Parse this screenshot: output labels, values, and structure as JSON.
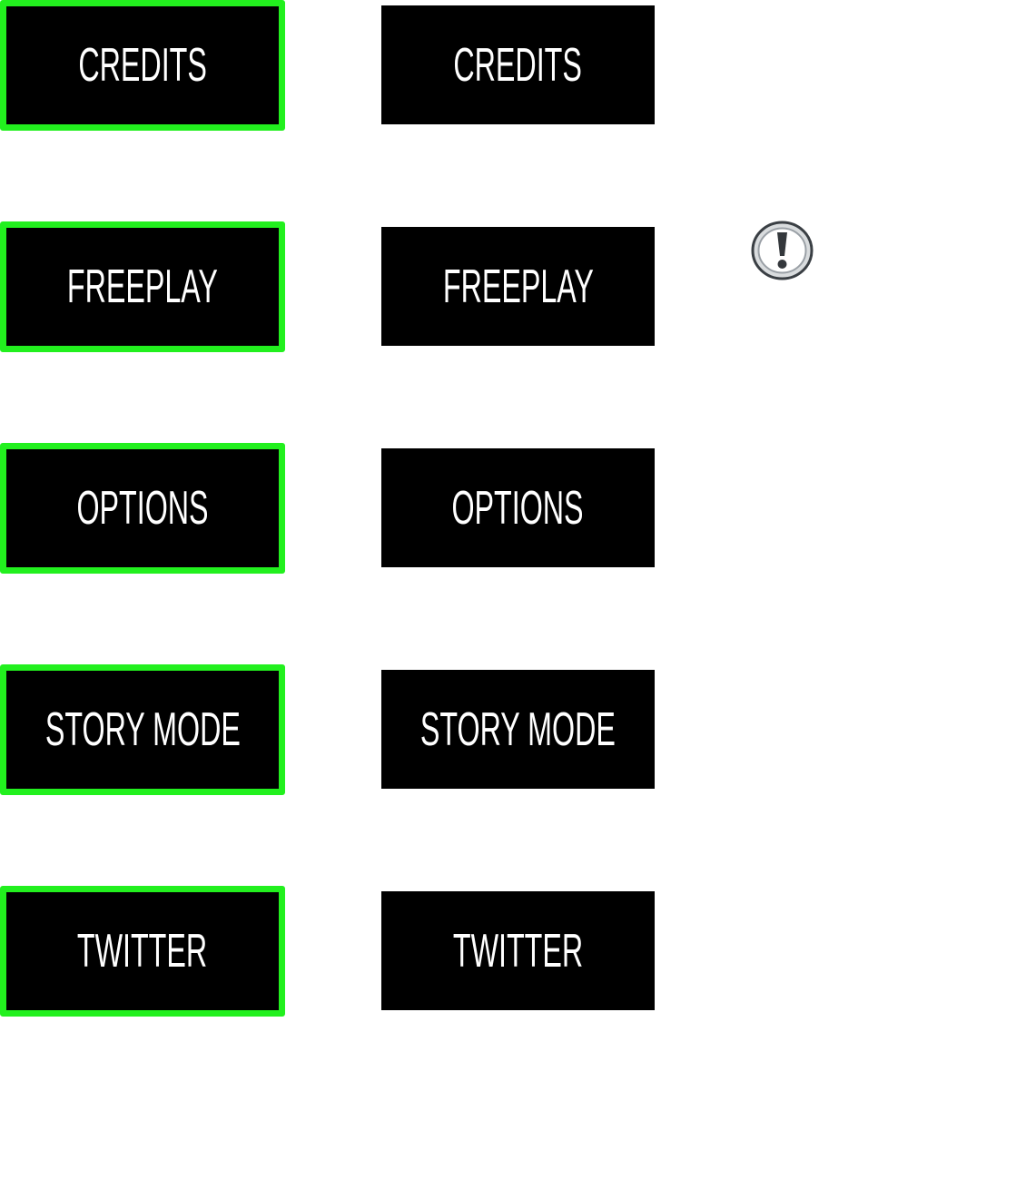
{
  "menu": {
    "buttons": [
      {
        "label": "CREDITS"
      },
      {
        "label": "FREEPLAY"
      },
      {
        "label": "OPTIONS"
      },
      {
        "label": "STORY MODE"
      },
      {
        "label": "TWITTER"
      }
    ],
    "selected_color": "#22f01e",
    "button_color": "#000000",
    "text_color": "#ffffff"
  },
  "icons": {
    "alert": "exclamation-badge-icon"
  }
}
